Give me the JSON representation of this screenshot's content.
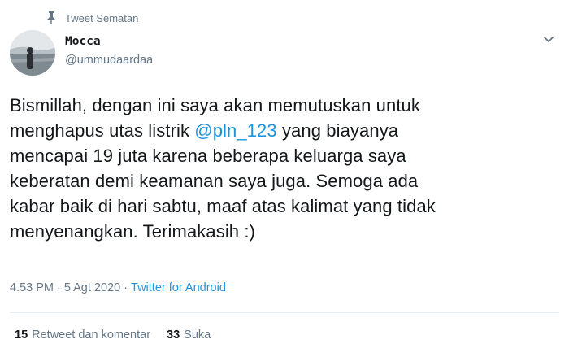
{
  "header": {
    "pinned_label": "Tweet Sematan",
    "pin_icon": "pin-icon"
  },
  "user": {
    "name": "Mocca",
    "handle": "@ummudaardaa",
    "menu_icon": "chevron-down-icon"
  },
  "tweet": {
    "line1": "Bismillah, dengan ini saya akan memutuskan untuk",
    "line2_before": "menghapus utas listrik ",
    "mention": "@pln_123",
    "line2_after": " yang biayanya",
    "line3": "mencapai 19 juta karena beberapa keluarga saya",
    "line4": "keberatan demi keamanan saya juga. Semoga ada",
    "line5": "kabar baik di hari sabtu, maaf atas kalimat yang tidak",
    "line6": "menyenangkan. Terimakasih :)"
  },
  "meta": {
    "time": "4.53 PM",
    "separator": "·",
    "date": "5 Agt 2020",
    "separator2": "·",
    "source": "Twitter for Android"
  },
  "stats": {
    "retweets_count": "15",
    "retweets_label": "Retweet dan komentar",
    "likes_count": "33",
    "likes_label": "Suka"
  },
  "colors": {
    "link": "#1b95e0",
    "secondary": "#657786",
    "text": "#14171a"
  }
}
